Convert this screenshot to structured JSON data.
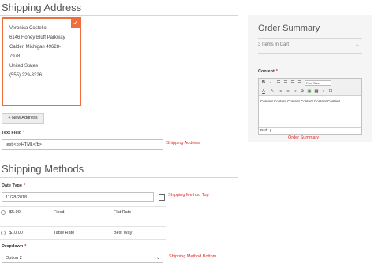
{
  "shipping_address": {
    "title": "Shipping Address",
    "card": {
      "name": "Veronica Costello",
      "street": "6146 Honey Bluff Parkway",
      "city_line": "Calder, Michigan 49628-",
      "zip_cont": "7978",
      "country": "United States",
      "phone": "(555) 229-3326",
      "check": "✓"
    },
    "new_address_label": "+ New Address",
    "text_field": {
      "label": "Text Field",
      "required": "*",
      "value": "test <b>HTML</b>",
      "hint": "Shipping Address"
    }
  },
  "order_summary": {
    "title": "Order Summary",
    "items_label": "3 Items in Cart",
    "content_label": "Content",
    "required": "*",
    "font_size_label": "Font Size",
    "editor_text": "Content Content Content Content Content Content",
    "path_label": "Path: p",
    "hint": "Order Summary"
  },
  "shipping_methods": {
    "title": "Shipping Methods",
    "date": {
      "label": "Date Type",
      "required": "*",
      "value": "11/28/2018",
      "hint": "Shipping Method Top"
    },
    "methods": [
      {
        "price": "$5.00",
        "type": "Fixed",
        "carrier": "Flat Rate"
      },
      {
        "price": "$10.00",
        "type": "Table Rate",
        "carrier": "Best Way"
      }
    ],
    "dropdown": {
      "label": "Dropdown",
      "required": "*",
      "value": "Option 2",
      "hint": "Shipping Method Bottom"
    }
  },
  "colors": {
    "accent": "#f26b3a",
    "error": "#e02b27"
  }
}
